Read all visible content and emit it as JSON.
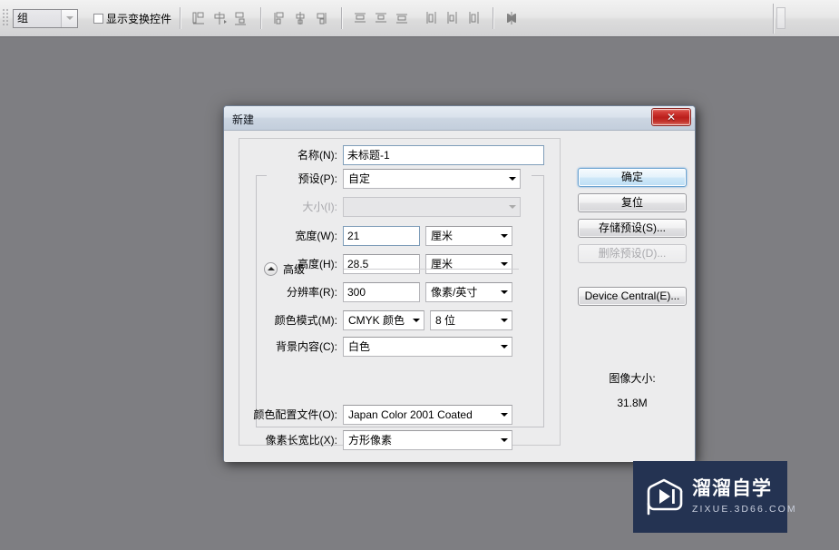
{
  "toolbar": {
    "group_combo": {
      "value": "组"
    },
    "show_transform": {
      "label": "显示变换控件",
      "checked": false
    },
    "align_icons": [
      "align-left-edges-icon",
      "align-horizontal-centers-icon",
      "align-right-edges-icon",
      "align-top-edges-icon",
      "align-vertical-centers-icon",
      "align-bottom-edges-icon",
      "distribute-top-edges-icon",
      "distribute-vertical-centers-icon",
      "distribute-bottom-edges-icon",
      "distribute-left-edges-icon",
      "distribute-horizontal-centers-icon",
      "distribute-right-edges-icon",
      "auto-align-layers-icon"
    ]
  },
  "dialog": {
    "title": "新建",
    "close_glyph": "✕",
    "fields": {
      "name_label": "名称(N):",
      "name_value": "未标题-1",
      "preset_label": "预设(P):",
      "preset_value": "自定",
      "size_label": "大小(I):",
      "size_value": "",
      "width_label": "宽度(W):",
      "width_value": "21",
      "width_unit": "厘米",
      "height_label": "高度(H):",
      "height_value": "28.5",
      "height_unit": "厘米",
      "resolution_label": "分辨率(R):",
      "resolution_value": "300",
      "resolution_unit": "像素/英寸",
      "colormode_label": "颜色模式(M):",
      "colormode_value": "CMYK 颜色",
      "bitdepth_value": "8 位",
      "background_label": "背景内容(C):",
      "background_value": "白色",
      "advanced_label": "高级",
      "colorprofile_label": "颜色配置文件(O):",
      "colorprofile_value": "Japan Color 2001 Coated",
      "pixelaspect_label": "像素长宽比(X):",
      "pixelaspect_value": "方形像素"
    },
    "buttons": {
      "ok": "确定",
      "reset": "复位",
      "save_preset": "存储预设(S)...",
      "delete_preset": "删除预设(D)...",
      "device_central": "Device Central(E)..."
    },
    "image_size_label": "图像大小:",
    "image_size_value": "31.8M"
  },
  "watermark": {
    "title": "溜溜自学",
    "subtitle": "ZIXUE.3D66.COM",
    "bg_color": "#243352"
  }
}
